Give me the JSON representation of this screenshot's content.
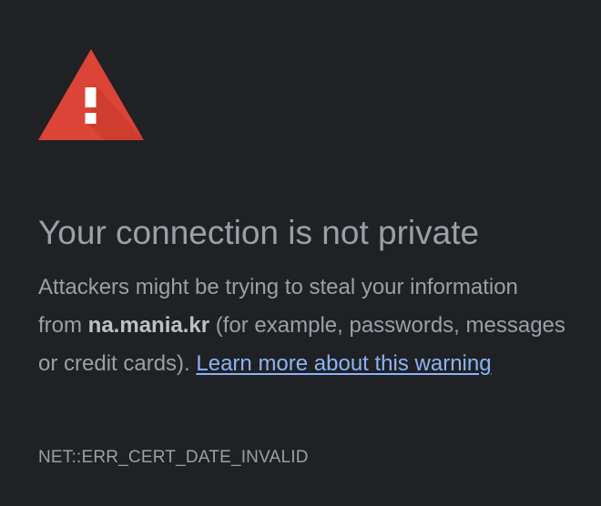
{
  "icon": {
    "name": "warning-triangle-icon",
    "color": "#db4437",
    "shadow_color": "#c53929",
    "mark_color": "#ffffff"
  },
  "title": "Your connection is not private",
  "description": {
    "line_before_domain": "Attackers might be trying to steal your information from",
    "domain": "na.mania.kr",
    "after_domain": "(for example, passwords, messages or credit cards).",
    "learn_more_link": "Learn more about this warning"
  },
  "error_code": "NET::ERR_CERT_DATE_INVALID",
  "colors": {
    "background": "#202124",
    "text": "#9aa0a6",
    "link": "#8ab4f8"
  }
}
